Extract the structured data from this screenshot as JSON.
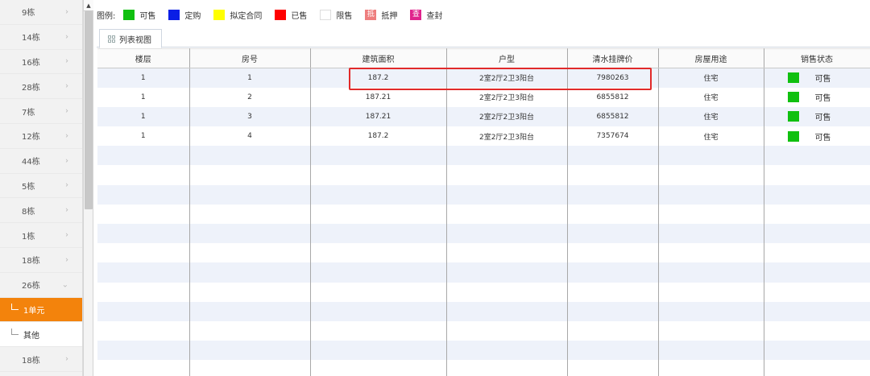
{
  "sidebar": {
    "items": [
      {
        "label": "9栋"
      },
      {
        "label": "14栋"
      },
      {
        "label": "16栋"
      },
      {
        "label": "28栋"
      },
      {
        "label": "7栋"
      },
      {
        "label": "12栋"
      },
      {
        "label": "44栋"
      },
      {
        "label": "5栋"
      },
      {
        "label": "8栋"
      },
      {
        "label": "1栋"
      },
      {
        "label": "18栋"
      },
      {
        "label": "26栋"
      }
    ],
    "sub_items": [
      {
        "label": "1单元",
        "active": true
      },
      {
        "label": "其他",
        "active": false
      }
    ],
    "last_item": {
      "label": "18栋"
    }
  },
  "legend": {
    "title": "图例:",
    "items": [
      {
        "label": "可售",
        "color": "#10c010",
        "glyph": ""
      },
      {
        "label": "定购",
        "color": "#0a1ee6",
        "glyph": ""
      },
      {
        "label": "拟定合同",
        "color": "#ffff00",
        "glyph": ""
      },
      {
        "label": "已售",
        "color": "#ff0000",
        "glyph": ""
      },
      {
        "label": "限售",
        "color": "#ffffff",
        "glyph": ""
      },
      {
        "label": "抵押",
        "color": "#ee7e7e",
        "glyph": "抵"
      },
      {
        "label": "查封",
        "color": "#e0238c",
        "glyph": "查"
      }
    ]
  },
  "tabs": {
    "list_view": "列表视图"
  },
  "table": {
    "columns": [
      "楼层",
      "房号",
      "建筑面积",
      "户型",
      "清水挂牌价",
      "房屋用途",
      "销售状态"
    ],
    "rows": [
      {
        "floor": "1",
        "room": "1",
        "area": "187.2",
        "layout": "2室2厅2卫3阳台",
        "price": "7980263",
        "use": "住宅",
        "status": "可售",
        "status_color": "#10c010"
      },
      {
        "floor": "1",
        "room": "2",
        "area": "187.21",
        "layout": "2室2厅2卫3阳台",
        "price": "6855812",
        "use": "住宅",
        "status": "可售",
        "status_color": "#10c010"
      },
      {
        "floor": "1",
        "room": "3",
        "area": "187.21",
        "layout": "2室2厅2卫3阳台",
        "price": "6855812",
        "use": "住宅",
        "status": "可售",
        "status_color": "#10c010"
      },
      {
        "floor": "1",
        "room": "4",
        "area": "187.2",
        "layout": "2室2厅2卫3阳台",
        "price": "7357674",
        "use": "住宅",
        "status": "可售",
        "status_color": "#10c010"
      }
    ],
    "empty_rows": 12
  },
  "highlight": {
    "color": "#e12a2a"
  }
}
